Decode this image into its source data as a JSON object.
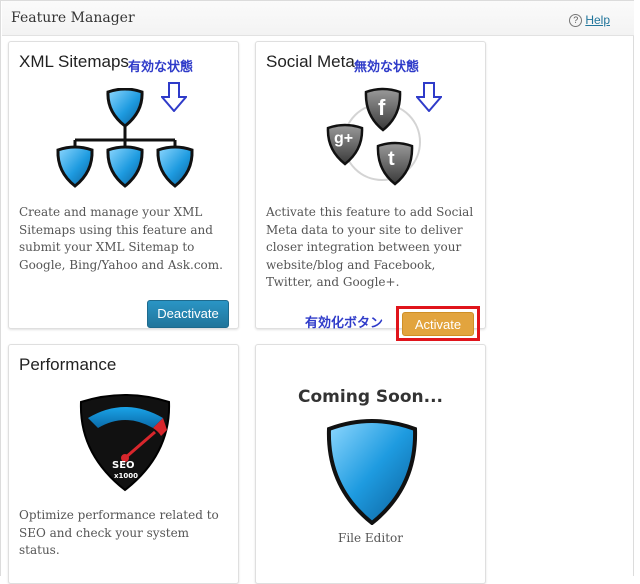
{
  "header": {
    "title": "Feature Manager",
    "help_label": "Help",
    "help_icon": "?"
  },
  "cards": {
    "xml_sitemaps": {
      "title": "XML Sitemaps",
      "annotation": "有効な状態",
      "description": "Create and manage your XML Sitemaps using this feature and submit your XML Sitemap to Google, Bing/Yahoo and Ask.com.",
      "button_label": "Deactivate"
    },
    "social_meta": {
      "title": "Social Meta",
      "annotation": "無効な状態",
      "description": "Activate this feature to add Social Meta data to your site to deliver closer integration between your website/blog and Facebook, Twitter, and Google+.",
      "button_label": "Activate",
      "button_annotation": "有効化ボタン",
      "icon_labels": {
        "facebook": "f",
        "google_plus": "g+",
        "twitter": "t"
      }
    },
    "performance": {
      "title": "Performance",
      "description": "Optimize performance related to SEO and check your system status.",
      "gauge_labels": {
        "main": "SEO",
        "sub": "x1000"
      }
    },
    "file_editor": {
      "coming_soon": "Coming Soon...",
      "label": "File Editor"
    }
  },
  "colors": {
    "accent_blue": "#21759b",
    "activate_orange": "#e2a43e",
    "highlight_red": "#e0141b",
    "annotation_blue": "#2f3bc9"
  }
}
